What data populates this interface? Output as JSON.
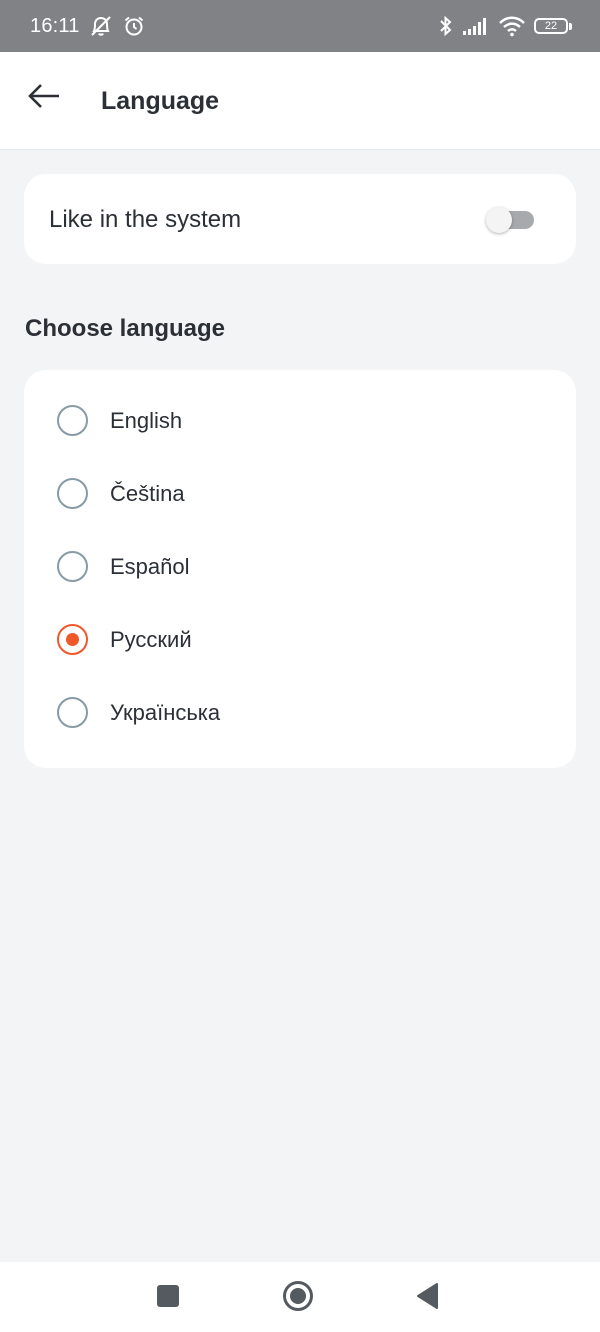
{
  "status_bar": {
    "time": "16:11",
    "battery": "22",
    "icons": [
      "muted-bell-icon",
      "alarm-icon",
      "bluetooth-icon",
      "signal-icon",
      "wifi-icon",
      "battery-icon"
    ]
  },
  "header": {
    "title": "Language",
    "back_icon": "arrow-left-icon"
  },
  "system_setting": {
    "label": "Like in the system",
    "enabled": false
  },
  "section": {
    "heading": "Choose language"
  },
  "languages": [
    {
      "label": "English",
      "selected": false
    },
    {
      "label": "Čeština",
      "selected": false
    },
    {
      "label": "Español",
      "selected": false
    },
    {
      "label": "Русский",
      "selected": true
    },
    {
      "label": "Українська",
      "selected": false
    }
  ],
  "navigation": {
    "icons": [
      "square-icon",
      "home-circle-icon",
      "back-triangle-icon"
    ]
  },
  "colors": {
    "accent": "#f0582a",
    "radio_unselected": "#879ba6",
    "background": "#f3f4f6",
    "status_bar": "#808285"
  }
}
